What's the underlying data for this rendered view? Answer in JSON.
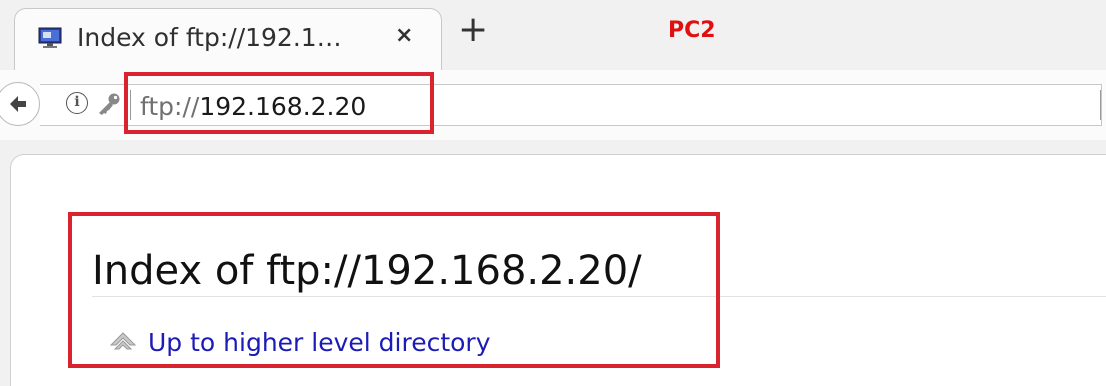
{
  "tab": {
    "title": "Index of ftp://192.1…",
    "close_glyph": "×",
    "favicon": "monitor-icon"
  },
  "new_tab_glyph": "+",
  "annotation": {
    "label": "PC2",
    "label_color": "#e01010",
    "highlight_color": "#d9232e"
  },
  "urlbar": {
    "scheme": "ftp://",
    "host": "192.168.2.20"
  },
  "page": {
    "heading": "Index of ftp://192.168.2.20/",
    "up_link_label": "Up to higher level directory",
    "link_color": "#1b1bb8"
  }
}
